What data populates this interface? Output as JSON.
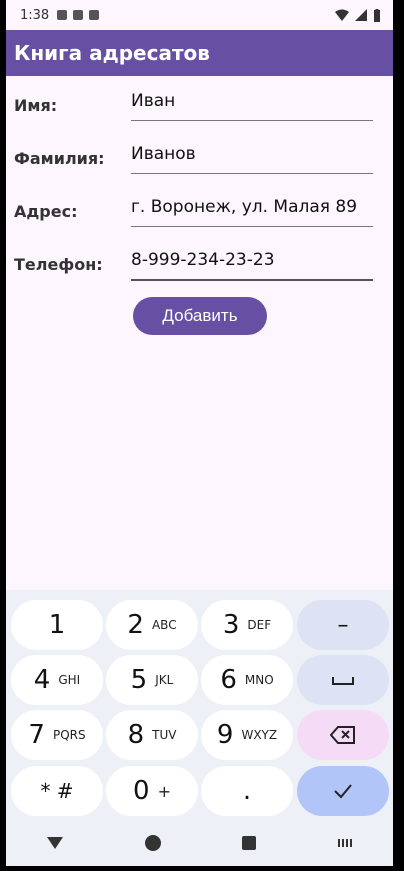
{
  "status": {
    "time": "1:38"
  },
  "appbar": {
    "title": "Книга адресатов"
  },
  "form": {
    "fields": [
      {
        "label": "Имя:",
        "value": "Иван"
      },
      {
        "label": "Фамилия:",
        "value": "Иванов"
      },
      {
        "label": "Адрес:",
        "value": "г. Воронеж, ул. Малая 89"
      },
      {
        "label": "Телефон:",
        "value": "8-999-234-23-23"
      }
    ],
    "add_button": "Добавить"
  },
  "keyboard": {
    "keys": [
      {
        "digit": "1",
        "letters": ""
      },
      {
        "digit": "2",
        "letters": "ABC"
      },
      {
        "digit": "3",
        "letters": "DEF"
      },
      {
        "digit": "4",
        "letters": "GHI"
      },
      {
        "digit": "5",
        "letters": "JKL"
      },
      {
        "digit": "6",
        "letters": "MNO"
      },
      {
        "digit": "7",
        "letters": "PQRS"
      },
      {
        "digit": "8",
        "letters": "TUV"
      },
      {
        "digit": "9",
        "letters": "WXYZ"
      },
      {
        "digit": "* #",
        "letters": ""
      },
      {
        "digit": "0",
        "letters": "+"
      },
      {
        "digit": ".",
        "letters": ""
      }
    ],
    "minus": "–"
  },
  "colors": {
    "primary": "#6750a4",
    "background": "#fdf6fe",
    "key_special": "#dde3f4",
    "key_delete": "#f6dbf7",
    "key_enter": "#b1c5f9"
  }
}
